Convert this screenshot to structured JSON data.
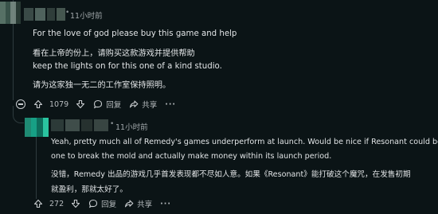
{
  "comment": {
    "timestamp": "11小时前",
    "separator": "•",
    "lines": [
      "For the love of god please buy this game and help",
      "看在上帝的份上，请购买这款游戏并提供帮助",
      "keep the lights on for this one of a kind studio.",
      "请为这家独一无二的工作室保持照明。"
    ],
    "score": "1079",
    "reply_label": "回复",
    "share_label": "共享",
    "more_label": "···"
  },
  "reply": {
    "timestamp": "11小时前",
    "separator": "•",
    "lines": [
      "Yeah, pretty much all of Remedy's games underperform at launch. Would be nice if Resonant could be the",
      "one to break the mold and actually make money within its launch period.",
      "没错，Remedy 出品的游戏几乎首发表现都不尽如人意。如果《Resonant》能打破这个魔咒，在发售初期",
      "就盈利，那就太好了。"
    ],
    "score": "272",
    "reply_label": "回复",
    "share_label": "共享",
    "more_label": "···"
  },
  "colors": {
    "background": "#0b1416",
    "text": "#e1e4e6",
    "meta": "#a1a8ab",
    "thread_line": "#2e3b3e",
    "avatar_top": [
      "#5f7a6e",
      "#3f5a50",
      "#7c8f87",
      "#2d3f38"
    ],
    "avatar_reply": [
      "#1f8a73",
      "#17a085",
      "#0e6e5c",
      "#2ac4a0"
    ]
  },
  "icons": {
    "upvote": "arrow-up-icon",
    "downvote": "arrow-down-icon",
    "reply": "speech-bubble-icon",
    "share": "share-arrow-icon",
    "collapse": "collapse-minus-icon"
  }
}
